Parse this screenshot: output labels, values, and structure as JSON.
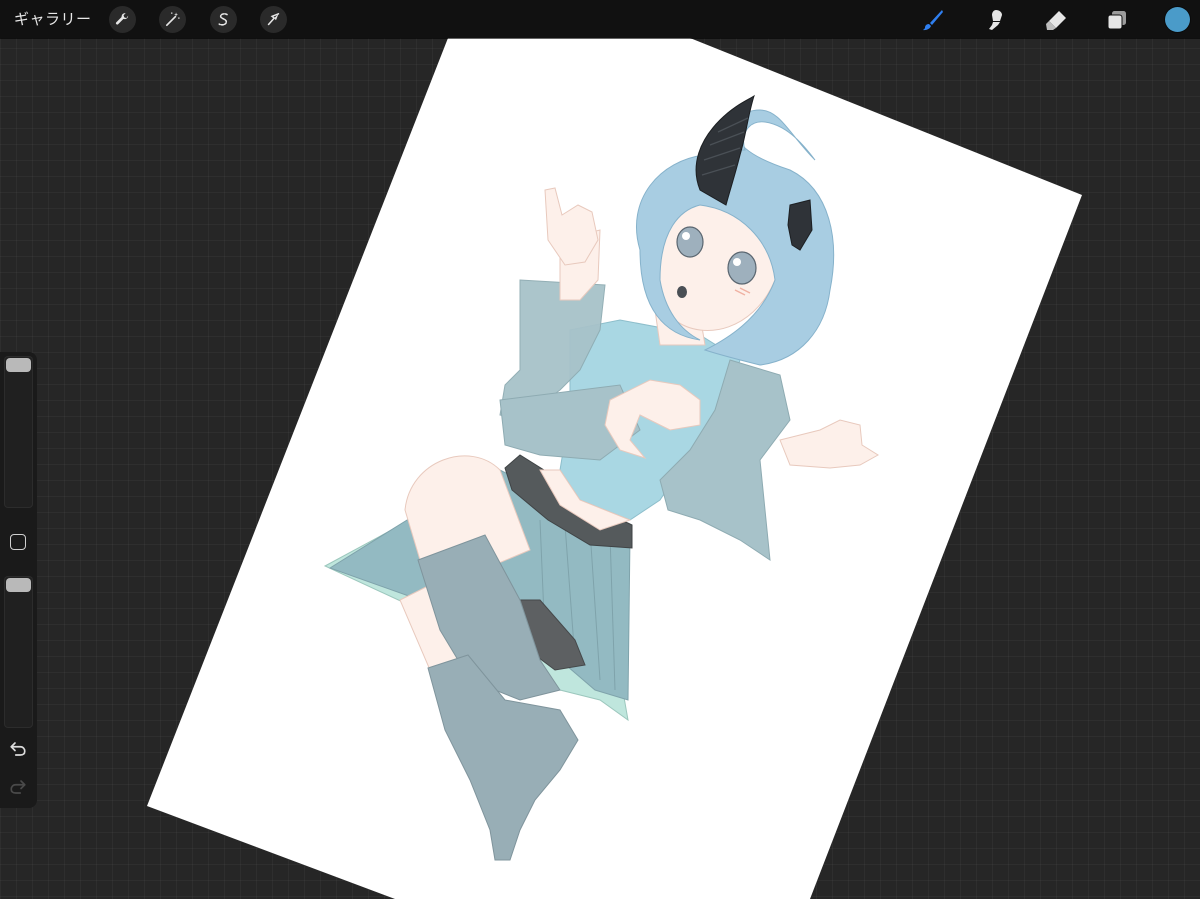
{
  "toolbar": {
    "gallery_label": "ギャラリー",
    "left_tools": [
      {
        "name": "actions",
        "icon": "wrench-icon"
      },
      {
        "name": "adjustments",
        "icon": "magic-wand-icon"
      },
      {
        "name": "selection",
        "icon": "selection-s-icon"
      },
      {
        "name": "transform",
        "icon": "arrow-cursor-icon"
      }
    ],
    "right_tools": [
      {
        "name": "brush",
        "icon": "brush-icon",
        "active": true
      },
      {
        "name": "smudge",
        "icon": "smudge-icon",
        "active": false
      },
      {
        "name": "eraser",
        "icon": "eraser-icon",
        "active": false
      },
      {
        "name": "layers",
        "icon": "layers-icon",
        "active": false
      }
    ],
    "current_color": "#4a9bc9",
    "active_tool_color": "#2f7ff0"
  },
  "sidebar": {
    "brush_size_level": 0.0,
    "opacity_level": 0.0,
    "buttons": [
      "modify-square-icon",
      "undo-icon",
      "redo-icon"
    ],
    "redo_enabled": false
  },
  "canvas": {
    "background": "#ffffff",
    "artwork": "anime-girl-with-horns-illustration",
    "palette": {
      "hair": "#a8cde2",
      "horn": "#2f3338",
      "skin": "#fdf0ea",
      "top": "#a9d7e3",
      "sleeves": "#a7c2c9",
      "skirt": "#93bac2",
      "skirt_lining": "#bfe6dd",
      "socks": "#98aeb6",
      "belt": "#555a5c",
      "shoes": "#5d6062",
      "eyes": "#9eb0bd"
    }
  }
}
